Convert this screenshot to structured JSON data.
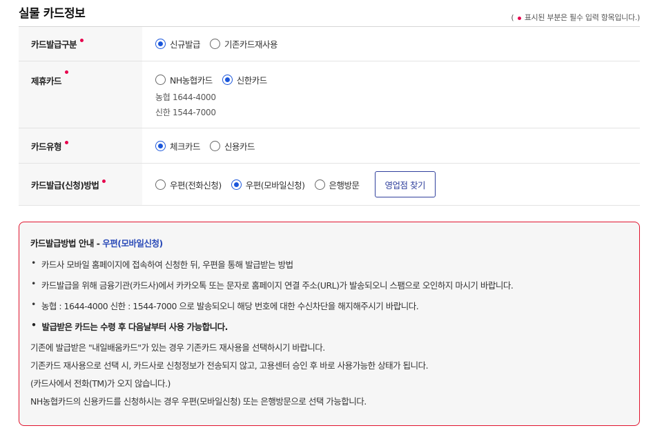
{
  "page": {
    "title": "실물 카드정보",
    "required_note_open": "(",
    "required_note_text": "표시된 부분은 필수 입력 항목입니다.)"
  },
  "form": {
    "issue_type": {
      "label": "카드발급구분",
      "options": [
        {
          "label": "신규발급",
          "selected": true
        },
        {
          "label": "기존카드재사용",
          "selected": false
        }
      ]
    },
    "partner_card": {
      "label": "제휴카드",
      "options": [
        {
          "label": "NH농협카드",
          "selected": false
        },
        {
          "label": "신한카드",
          "selected": true
        }
      ],
      "phones": [
        "농협 1644-4000",
        "신한 1544-7000"
      ]
    },
    "card_type": {
      "label": "카드유형",
      "options": [
        {
          "label": "체크카드",
          "selected": true
        },
        {
          "label": "신용카드",
          "selected": false
        }
      ]
    },
    "issue_method": {
      "label": "카드발급(신청)방법",
      "options": [
        {
          "label": "우편(전화신청)",
          "selected": false
        },
        {
          "label": "우편(모바일신청)",
          "selected": true
        },
        {
          "label": "은행방문",
          "selected": false
        }
      ],
      "branch_button": "영업점 찾기"
    }
  },
  "guide": {
    "title_prefix": "카드발급방법 안내 - ",
    "title_method": "우편(모바일신청)",
    "bullets": [
      "카드사 모바일 홈페이지에 접속하여 신청한 뒤, 우편을 통해 발급받는 방법",
      "카드발급을 위해 금융기관(카드사)에서 카카오톡 또는 문자로 홈페이지 연결 주소(URL)가 발송되오니 스팸으로 오인하지 마시기 바랍니다.",
      "농협 : 1644-4000 신한 : 1544-7000 으로 발송되오니 해당 번호에 대한 수신차단을 해지해주시기 바랍니다.",
      "발급받은 카드는 수령 후 다음날부터 사용 가능합니다."
    ],
    "notes": [
      "기존에 발급받은 \"내일배움카드\"가 있는 경우 기존카드 재사용을 선택하시기 바랍니다.",
      "기존카드 재사용으로 선택 시, 카드사로 신청정보가 전송되지 않고, 고용센터 승인 후 바로 사용가능한 상태가 됩니다.",
      "(카드사에서 전화(TM)가 오지 않습니다.)",
      "NH농협카드의 신용카드를 신청하시는 경우 우편(모바일신청) 또는 은행방문으로 선택 가능합니다."
    ]
  },
  "colors": {
    "required_dot": "#e6004c",
    "radio_selected": "#1a56db",
    "guide_border": "#e0122c",
    "method_highlight": "#2b4bb8"
  }
}
